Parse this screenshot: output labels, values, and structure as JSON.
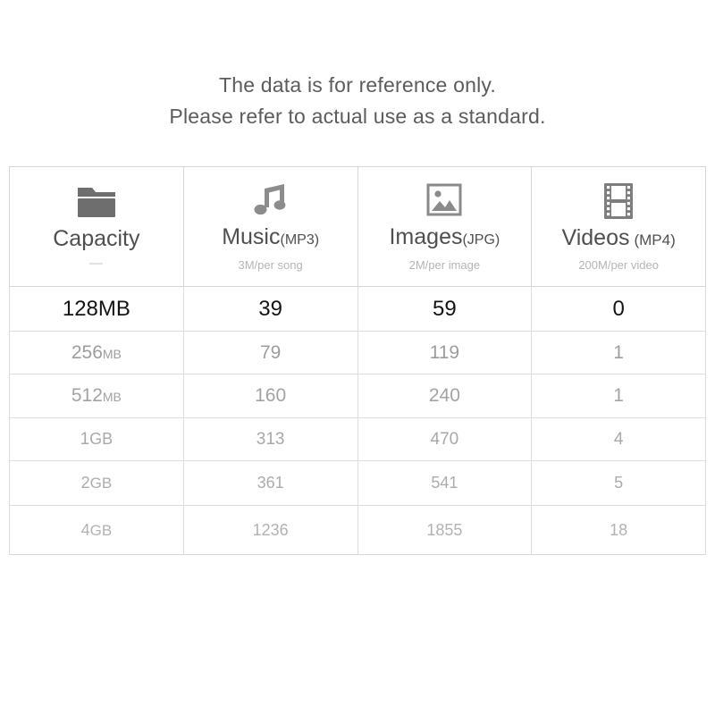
{
  "notice": {
    "line1": "The data is for reference only.",
    "line2": "Please refer to actual use as a standard."
  },
  "table": {
    "columns": [
      {
        "icon": "folder-icon",
        "title": "Capacity",
        "unit": "",
        "subtitle": "—"
      },
      {
        "icon": "music-note-icon",
        "title": "Music",
        "unit": "(MP3)",
        "subtitle": "3M/per song"
      },
      {
        "icon": "image-icon",
        "title": "Images",
        "unit": "(JPG)",
        "subtitle": "2M/per image"
      },
      {
        "icon": "film-strip-icon",
        "title": "Videos",
        "unit": "(MP4)",
        "subtitle": "200M/per video"
      }
    ],
    "rows": [
      {
        "capacity_value": "128",
        "capacity_unit": "MB",
        "music": "39",
        "images": "59",
        "videos": "0"
      },
      {
        "capacity_value": "256",
        "capacity_unit": "MB",
        "music": "79",
        "images": "119",
        "videos": "1"
      },
      {
        "capacity_value": "512",
        "capacity_unit": "MB",
        "music": "160",
        "images": "240",
        "videos": "1"
      },
      {
        "capacity_value": "1",
        "capacity_unit": "GB",
        "music": "313",
        "images": "470",
        "videos": "4"
      },
      {
        "capacity_value": "2",
        "capacity_unit": "GB",
        "music": "361",
        "images": "541",
        "videos": "5"
      },
      {
        "capacity_value": "4",
        "capacity_unit": "GB",
        "music": "1236",
        "images": "1855",
        "videos": "18"
      }
    ]
  },
  "colors": {
    "background": "#ffffff",
    "notice_text": "#5c5c5c",
    "header_title": "#4f4f4f",
    "header_subtitle": "#b5b5b5",
    "icon": "#7d7d7d",
    "border": "#d6d6d6",
    "row_first_text": "#141414"
  }
}
